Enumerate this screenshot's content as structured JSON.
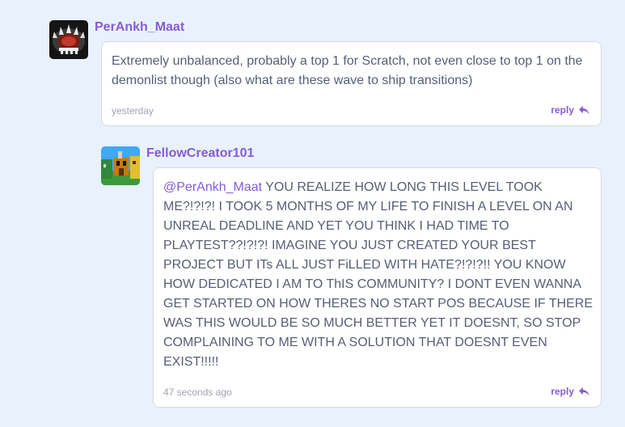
{
  "comments": [
    {
      "username": "PerAnkh_Maat",
      "text": "Extremely unbalanced, probably a top 1 for Scratch, not even close to top 1 on the demonlist though (also what are these wave to ship transitions)",
      "time": "yesterday",
      "reply_label": "reply"
    },
    {
      "username": "FellowCreator101",
      "mention": "@PerAnkh_Maat",
      "text": " YOU REALIZE HOW LONG THIS LEVEL TOOK ME?!?!?! I TOOK 5 MONTHS OF MY LIFE TO FINISH A LEVEL ON AN UNREAL DEADLINE AND YET YOU THINK I HAD TIME TO PLAYTEST??!?!?! IMAGINE YOU JUST CREATED YOUR BEST PROJECT BUT ITs ALL JUST FiLLED WITH HATE?!?!?!! YOU KNOW HOW DEDICATED I AM TO ThIS COMMUNITY? I DONT EVEN WANNA GET STARTED ON HOW THERES NO START POS BECAUSE IF THERE WAS THIS WOULD BE SO MUCH BETTER YET IT DOESNT, SO STOP COMPLAINING TO ME WITH A SOLUTION THAT DOESNT EVEN EXIST!!!!!",
      "time": "47 seconds ago",
      "reply_label": "reply"
    }
  ],
  "colors": {
    "background": "#e9f1fc",
    "username": "#855cd6",
    "text": "#575e75",
    "timestamp": "#9ea3ad"
  }
}
